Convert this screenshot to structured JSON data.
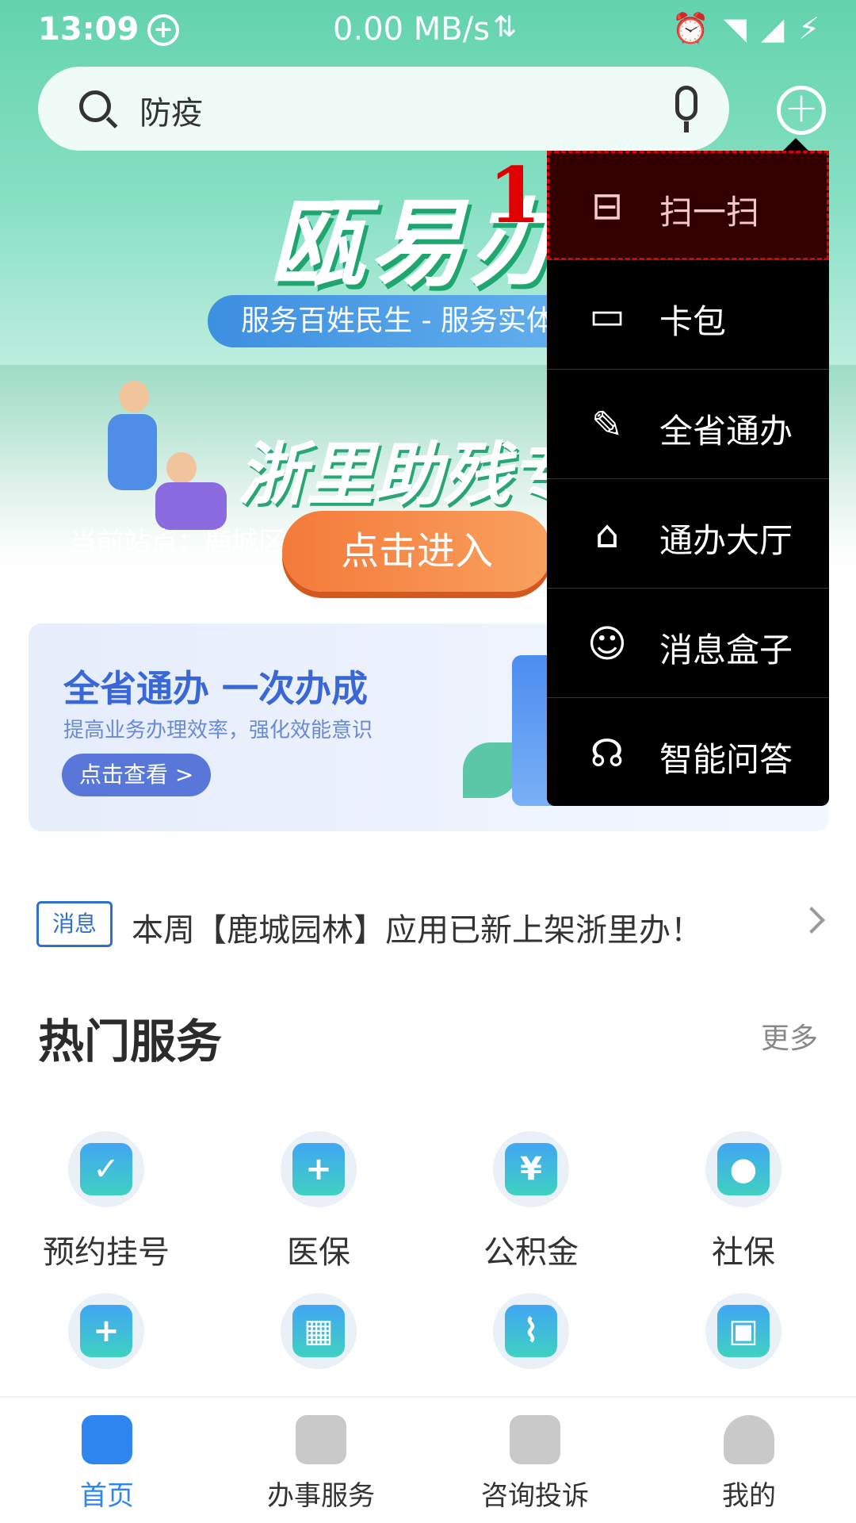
{
  "status_bar": {
    "time": "13:09",
    "speed": "0.00 MB/s",
    "right_icons": [
      "alarm-icon",
      "wifi-icon",
      "signal-icon",
      "battery-icon"
    ]
  },
  "search": {
    "placeholder": "防疫"
  },
  "banner": {
    "title": "瓯易办",
    "subtitle": "服务百姓民生 - 服务实体经济",
    "caption": "浙里助残专区",
    "station": "当前站点：鹿城区",
    "enter_button": "点击进入"
  },
  "promo": {
    "title": "全省通办 一次办成",
    "subtitle": "提高业务办理效率，强化效能意识",
    "button": "点击查看 >"
  },
  "notice": {
    "tag": "消息",
    "message": "本周【鹿城园林】应用已新上架浙里办！"
  },
  "hot_services": {
    "title": "热门服务",
    "more": "更多",
    "items": [
      {
        "label": "预约挂号",
        "icon": "calendar-check-icon"
      },
      {
        "label": "医保",
        "icon": "medical-kit-icon"
      },
      {
        "label": "公积金",
        "icon": "house-yuan-icon"
      },
      {
        "label": "社保",
        "icon": "shield-person-icon"
      },
      {
        "label": "",
        "icon": "shield-plus-icon"
      },
      {
        "label": "",
        "icon": "qrcode-icon"
      },
      {
        "label": "",
        "icon": "deer-icon"
      },
      {
        "label": "",
        "icon": "id-card-search-icon"
      }
    ]
  },
  "menu": {
    "items": [
      {
        "label": "扫一扫",
        "icon": "scan-icon"
      },
      {
        "label": "卡包",
        "icon": "card-wallet-icon"
      },
      {
        "label": "全省通办",
        "icon": "edit-icon"
      },
      {
        "label": "通办大厅",
        "icon": "home-icon"
      },
      {
        "label": "消息盒子",
        "icon": "chat-bubble-icon"
      },
      {
        "label": "智能问答",
        "icon": "robot-icon"
      }
    ],
    "highlight_marker": "1"
  },
  "bottom_nav": {
    "items": [
      {
        "label": "首页",
        "icon": "home-bag-icon",
        "active": true
      },
      {
        "label": "办事服务",
        "icon": "document-clock-icon",
        "active": false
      },
      {
        "label": "咨询投诉",
        "icon": "people-voice-icon",
        "active": false
      },
      {
        "label": "我的",
        "icon": "user-icon",
        "active": false
      }
    ]
  },
  "colors": {
    "accent": "#2f86f0",
    "menu_bg": "#000000",
    "highlight": "#e00000"
  }
}
